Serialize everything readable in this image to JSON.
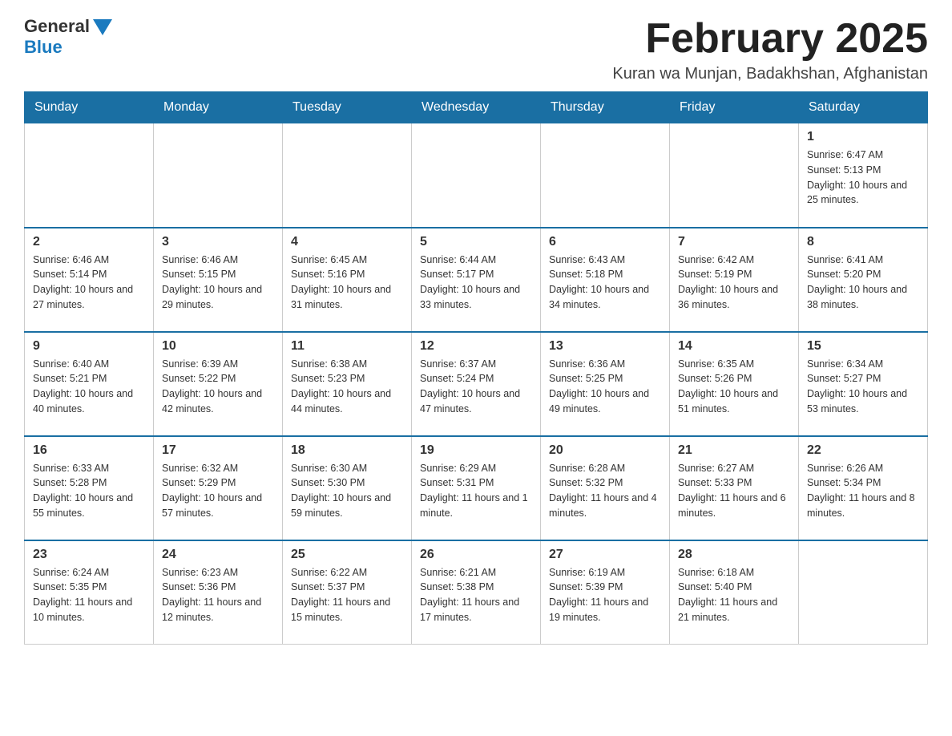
{
  "logo": {
    "general": "General",
    "blue": "Blue"
  },
  "title": {
    "month": "February 2025",
    "location": "Kuran wa Munjan, Badakhshan, Afghanistan"
  },
  "days_of_week": [
    "Sunday",
    "Monday",
    "Tuesday",
    "Wednesday",
    "Thursday",
    "Friday",
    "Saturday"
  ],
  "weeks": [
    [
      {
        "day": "",
        "info": ""
      },
      {
        "day": "",
        "info": ""
      },
      {
        "day": "",
        "info": ""
      },
      {
        "day": "",
        "info": ""
      },
      {
        "day": "",
        "info": ""
      },
      {
        "day": "",
        "info": ""
      },
      {
        "day": "1",
        "info": "Sunrise: 6:47 AM\nSunset: 5:13 PM\nDaylight: 10 hours and 25 minutes."
      }
    ],
    [
      {
        "day": "2",
        "info": "Sunrise: 6:46 AM\nSunset: 5:14 PM\nDaylight: 10 hours and 27 minutes."
      },
      {
        "day": "3",
        "info": "Sunrise: 6:46 AM\nSunset: 5:15 PM\nDaylight: 10 hours and 29 minutes."
      },
      {
        "day": "4",
        "info": "Sunrise: 6:45 AM\nSunset: 5:16 PM\nDaylight: 10 hours and 31 minutes."
      },
      {
        "day": "5",
        "info": "Sunrise: 6:44 AM\nSunset: 5:17 PM\nDaylight: 10 hours and 33 minutes."
      },
      {
        "day": "6",
        "info": "Sunrise: 6:43 AM\nSunset: 5:18 PM\nDaylight: 10 hours and 34 minutes."
      },
      {
        "day": "7",
        "info": "Sunrise: 6:42 AM\nSunset: 5:19 PM\nDaylight: 10 hours and 36 minutes."
      },
      {
        "day": "8",
        "info": "Sunrise: 6:41 AM\nSunset: 5:20 PM\nDaylight: 10 hours and 38 minutes."
      }
    ],
    [
      {
        "day": "9",
        "info": "Sunrise: 6:40 AM\nSunset: 5:21 PM\nDaylight: 10 hours and 40 minutes."
      },
      {
        "day": "10",
        "info": "Sunrise: 6:39 AM\nSunset: 5:22 PM\nDaylight: 10 hours and 42 minutes."
      },
      {
        "day": "11",
        "info": "Sunrise: 6:38 AM\nSunset: 5:23 PM\nDaylight: 10 hours and 44 minutes."
      },
      {
        "day": "12",
        "info": "Sunrise: 6:37 AM\nSunset: 5:24 PM\nDaylight: 10 hours and 47 minutes."
      },
      {
        "day": "13",
        "info": "Sunrise: 6:36 AM\nSunset: 5:25 PM\nDaylight: 10 hours and 49 minutes."
      },
      {
        "day": "14",
        "info": "Sunrise: 6:35 AM\nSunset: 5:26 PM\nDaylight: 10 hours and 51 minutes."
      },
      {
        "day": "15",
        "info": "Sunrise: 6:34 AM\nSunset: 5:27 PM\nDaylight: 10 hours and 53 minutes."
      }
    ],
    [
      {
        "day": "16",
        "info": "Sunrise: 6:33 AM\nSunset: 5:28 PM\nDaylight: 10 hours and 55 minutes."
      },
      {
        "day": "17",
        "info": "Sunrise: 6:32 AM\nSunset: 5:29 PM\nDaylight: 10 hours and 57 minutes."
      },
      {
        "day": "18",
        "info": "Sunrise: 6:30 AM\nSunset: 5:30 PM\nDaylight: 10 hours and 59 minutes."
      },
      {
        "day": "19",
        "info": "Sunrise: 6:29 AM\nSunset: 5:31 PM\nDaylight: 11 hours and 1 minute."
      },
      {
        "day": "20",
        "info": "Sunrise: 6:28 AM\nSunset: 5:32 PM\nDaylight: 11 hours and 4 minutes."
      },
      {
        "day": "21",
        "info": "Sunrise: 6:27 AM\nSunset: 5:33 PM\nDaylight: 11 hours and 6 minutes."
      },
      {
        "day": "22",
        "info": "Sunrise: 6:26 AM\nSunset: 5:34 PM\nDaylight: 11 hours and 8 minutes."
      }
    ],
    [
      {
        "day": "23",
        "info": "Sunrise: 6:24 AM\nSunset: 5:35 PM\nDaylight: 11 hours and 10 minutes."
      },
      {
        "day": "24",
        "info": "Sunrise: 6:23 AM\nSunset: 5:36 PM\nDaylight: 11 hours and 12 minutes."
      },
      {
        "day": "25",
        "info": "Sunrise: 6:22 AM\nSunset: 5:37 PM\nDaylight: 11 hours and 15 minutes."
      },
      {
        "day": "26",
        "info": "Sunrise: 6:21 AM\nSunset: 5:38 PM\nDaylight: 11 hours and 17 minutes."
      },
      {
        "day": "27",
        "info": "Sunrise: 6:19 AM\nSunset: 5:39 PM\nDaylight: 11 hours and 19 minutes."
      },
      {
        "day": "28",
        "info": "Sunrise: 6:18 AM\nSunset: 5:40 PM\nDaylight: 11 hours and 21 minutes."
      },
      {
        "day": "",
        "info": ""
      }
    ]
  ]
}
